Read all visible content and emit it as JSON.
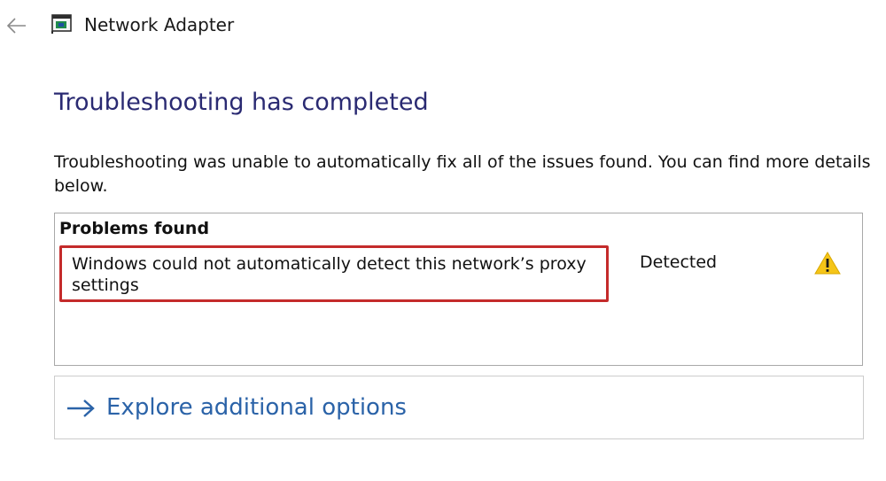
{
  "header": {
    "back_icon": "back-arrow-icon",
    "app_icon": "network-adapter-icon",
    "title": "Network Adapter"
  },
  "main": {
    "heading": "Troubleshooting has completed",
    "description": "Troubleshooting was unable to automatically fix all of the issues found. You can find more details below.",
    "heading_color": "#2a2a72"
  },
  "problems": {
    "header": "Problems found",
    "items": [
      {
        "text": "Windows could not automatically detect this network’s proxy settings",
        "status": "Detected",
        "status_icon": "warning-icon",
        "highlight_color": "#c42b2b"
      }
    ]
  },
  "explore": {
    "icon": "right-arrow-icon",
    "label": "Explore additional options",
    "link_color": "#2b63a8"
  }
}
